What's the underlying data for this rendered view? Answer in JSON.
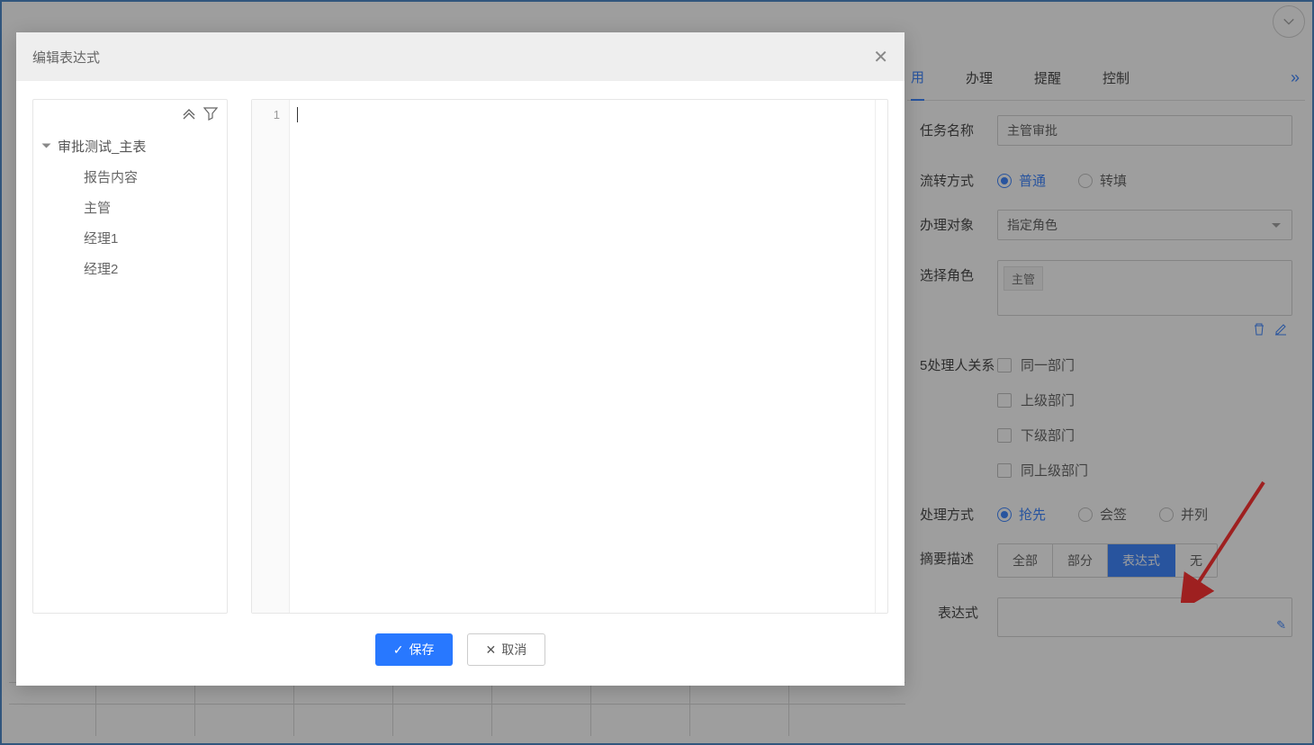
{
  "background": {
    "tabs": [
      "用",
      "办理",
      "提醒",
      "控制"
    ],
    "activeTabIndex": 0,
    "fields": {
      "taskNameLabel": "任务名称",
      "taskNameValue": "主管审批",
      "flowModeLabel": "流转方式",
      "flowModeOptions": [
        "普通",
        "转填"
      ],
      "flowModeSelectedIndex": 0,
      "handlerObjectLabel": "办理对象",
      "handlerObjectValue": "指定角色",
      "selectRoleLabel": "选择角色",
      "selectRoleTag": "主管",
      "relationLabel": "5处理人关系",
      "relationOptions": [
        "同一部门",
        "上级部门",
        "下级部门",
        "同上级部门"
      ],
      "processModeLabel": "处理方式",
      "processModeOptions": [
        "抢先",
        "会签",
        "并列"
      ],
      "processModeSelectedIndex": 0,
      "summaryLabel": "摘要描述",
      "summaryOptions": [
        "全部",
        "部分",
        "表达式",
        "无"
      ],
      "summaryActiveIndex": 2,
      "expressionLabel": "表达式"
    }
  },
  "modal": {
    "title": "编辑表达式",
    "tree": {
      "rootLabel": "审批测试_主表",
      "children": [
        "报告内容",
        "主管",
        "经理1",
        "经理2"
      ]
    },
    "editor": {
      "lineNumber": "1"
    },
    "buttons": {
      "save": "保存",
      "cancel": "取消"
    }
  }
}
